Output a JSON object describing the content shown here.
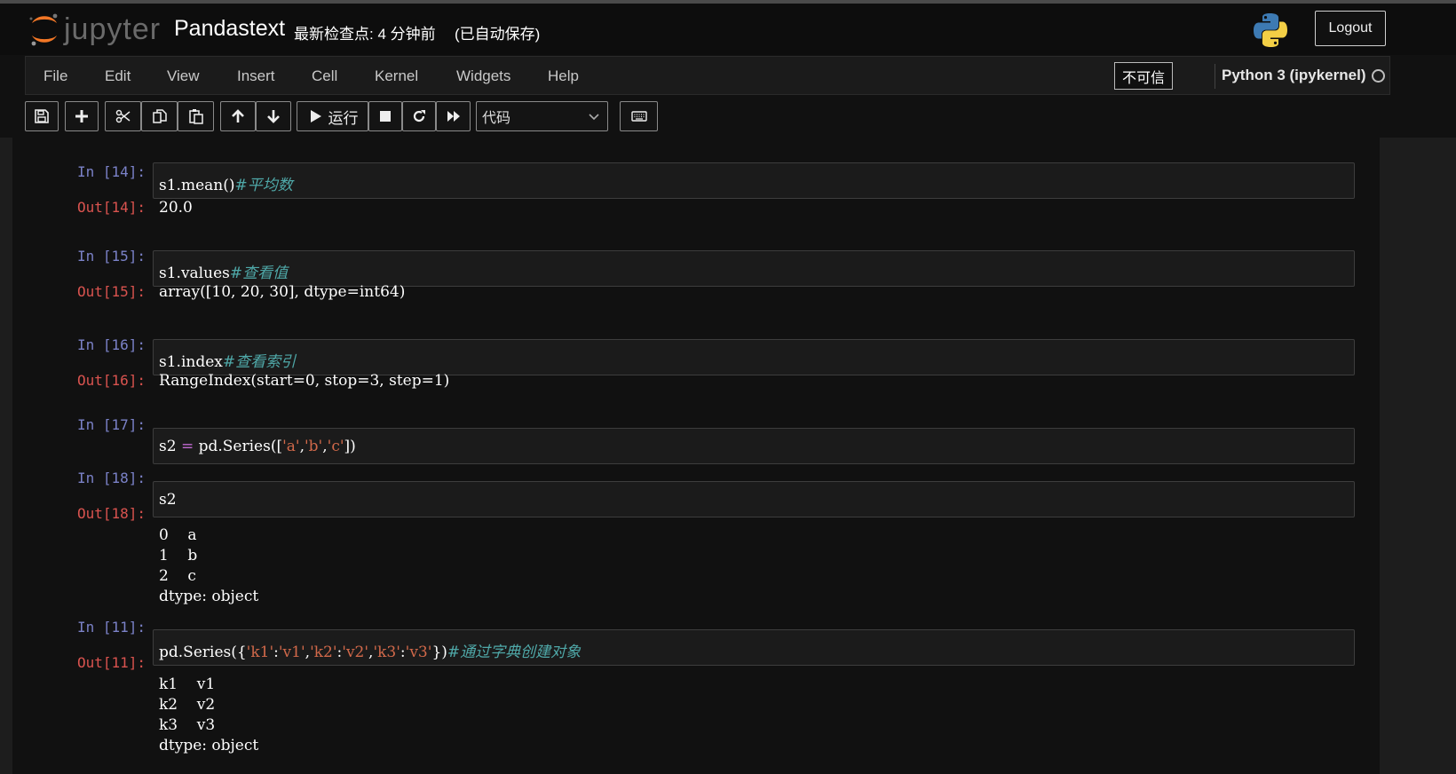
{
  "header": {
    "logo_text": "jupyter",
    "notebook_title": "Pandastext",
    "checkpoint": "最新检查点: 4 分钟前",
    "autosave": "(已自动保存)",
    "logout_label": "Logout"
  },
  "menubar": {
    "items": [
      "File",
      "Edit",
      "View",
      "Insert",
      "Cell",
      "Kernel",
      "Widgets",
      "Help"
    ],
    "trust_label": "不可信",
    "kernel_name": "Python 3 (ipykernel)"
  },
  "toolbar": {
    "run_label": "运行",
    "cell_type": "代码",
    "buttons": [
      "save-icon",
      "plus-icon",
      "cut-icon",
      "copy-icon",
      "paste-icon",
      "arrow-up-icon",
      "arrow-down-icon",
      "play-icon",
      "stop-icon",
      "restart-icon",
      "fast-forward-icon",
      "keyboard-icon"
    ]
  },
  "cells": [
    {
      "in_prompt": "In  [14]:",
      "code": [
        {
          "t": "s1.mean()",
          "c": ""
        },
        {
          "t": "#平均数",
          "c": "cm"
        }
      ],
      "out_prompt": "Out[14]:",
      "output": "20.0"
    },
    {
      "in_prompt": "In  [15]:",
      "code": [
        {
          "t": "s1.values",
          "c": ""
        },
        {
          "t": "#查看值",
          "c": "cm"
        }
      ],
      "out_prompt": "Out[15]:",
      "output": "array([10, 20, 30], dtype=int64)"
    },
    {
      "in_prompt": "In  [16]:",
      "code": [
        {
          "t": "s1.index",
          "c": ""
        },
        {
          "t": "#查看索引",
          "c": "cm"
        }
      ],
      "out_prompt": "Out[16]:",
      "output": "RangeIndex(start=0, stop=3, step=1)"
    },
    {
      "in_prompt": "In  [17]:",
      "code": [
        {
          "t": "s2 ",
          "c": ""
        },
        {
          "t": "=",
          "c": "op"
        },
        {
          "t": " pd.Series([",
          "c": ""
        },
        {
          "t": "'a'",
          "c": "str"
        },
        {
          "t": ",",
          "c": ""
        },
        {
          "t": "'b'",
          "c": "str"
        },
        {
          "t": ",",
          "c": ""
        },
        {
          "t": "'c'",
          "c": "str"
        },
        {
          "t": "])",
          "c": ""
        }
      ],
      "out_prompt": "",
      "output": ""
    },
    {
      "in_prompt": "In  [18]:",
      "code": [
        {
          "t": "s2",
          "c": ""
        }
      ],
      "out_prompt": "Out[18]:",
      "output": "0    a\n1    b\n2    c\ndtype: object"
    },
    {
      "in_prompt": "In  [11]:",
      "code": [
        {
          "t": "pd.Series({",
          "c": ""
        },
        {
          "t": "'k1'",
          "c": "str"
        },
        {
          "t": ":",
          "c": ""
        },
        {
          "t": "'v1'",
          "c": "str"
        },
        {
          "t": ",",
          "c": ""
        },
        {
          "t": "'k2'",
          "c": "str"
        },
        {
          "t": ":",
          "c": ""
        },
        {
          "t": "'v2'",
          "c": "str"
        },
        {
          "t": ",",
          "c": ""
        },
        {
          "t": "'k3'",
          "c": "str"
        },
        {
          "t": ":",
          "c": ""
        },
        {
          "t": "'v3'",
          "c": "str"
        },
        {
          "t": "})",
          "c": ""
        },
        {
          "t": "#通过字典创建对象",
          "c": "cm"
        }
      ],
      "out_prompt": "Out[11]:",
      "output": "k1    v1\nk2    v2\nk3    v3\ndtype: object"
    }
  ]
}
